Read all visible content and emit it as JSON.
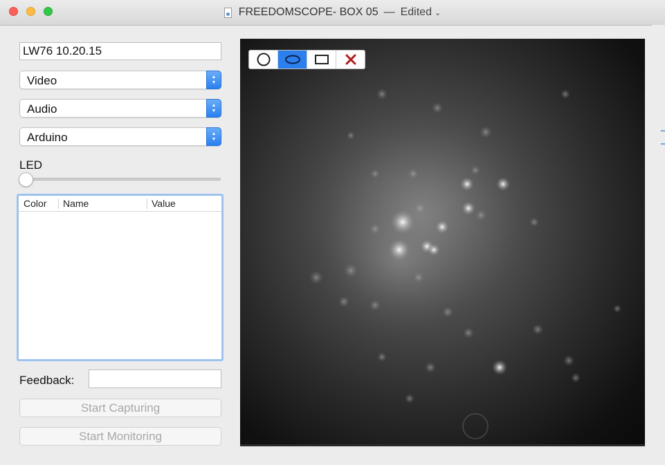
{
  "window": {
    "title": "FREEDOMSCOPE- BOX 05",
    "separator": "—",
    "status": "Edited",
    "chevron": "⌄"
  },
  "session_name": "LW76 10.20.15",
  "popups": {
    "video": "Video",
    "audio": "Audio",
    "arduino": "Arduino"
  },
  "led": {
    "label": "LED",
    "value": 0
  },
  "table": {
    "columns": [
      "Color",
      "Name",
      "Value"
    ],
    "rows": []
  },
  "feedback": {
    "label": "Feedback:",
    "value": ""
  },
  "buttons": {
    "start_capturing": "Start Capturing",
    "start_monitoring": "Start Monitoring"
  },
  "tools": [
    {
      "name": "circle-tool",
      "icon": "circle-icon",
      "active": false
    },
    {
      "name": "ellipse-tool",
      "icon": "ellipse-icon",
      "active": true
    },
    {
      "name": "rectangle-tool",
      "icon": "rectangle-icon",
      "active": false
    },
    {
      "name": "delete-tool",
      "icon": "x-icon",
      "active": false
    }
  ],
  "colors": {
    "accent": "#2b80ee",
    "delete": "#b31b1b",
    "table_focus": "#9ec2ef"
  }
}
